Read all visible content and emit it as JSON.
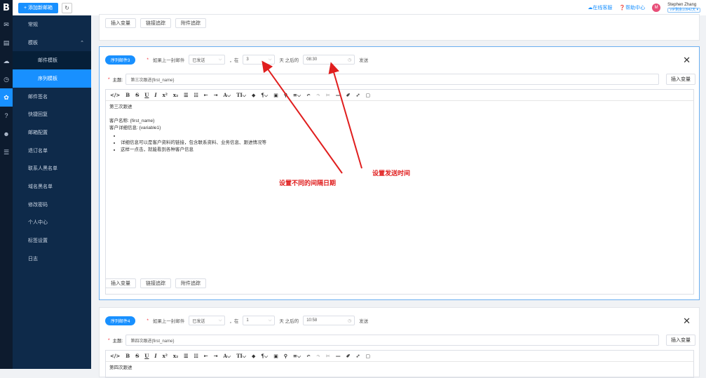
{
  "app": {
    "logo": "B"
  },
  "topbar": {
    "add_label": "+ 添加新邮箱",
    "online_service": "在线客服",
    "help_center": "帮助中心",
    "avatar_letter": "M",
    "user_name": "Stephen Zhang",
    "vip_label": "VIP剩余10942天 ▾"
  },
  "sidebar": {
    "items": [
      {
        "label": "常规"
      },
      {
        "label": "模板",
        "chevron": "⌃"
      },
      {
        "label": "邮件模板"
      },
      {
        "label": "序列模板"
      },
      {
        "label": "邮件签名"
      },
      {
        "label": "快捷回复"
      },
      {
        "label": "邮箱配置"
      },
      {
        "label": "退订名单"
      },
      {
        "label": "联系人黑名单"
      },
      {
        "label": "域名黑名单"
      },
      {
        "label": "修改密码"
      },
      {
        "label": "个人中心"
      },
      {
        "label": "标签设置"
      },
      {
        "label": "日志"
      }
    ]
  },
  "buttons": {
    "insert_variable": "插入变量",
    "link_tracking": "链接追踪",
    "attachment_tracking": "附件追踪",
    "insert_variable_subject": "插入变量"
  },
  "sequence3": {
    "tag": "序列邮件3",
    "condition_label": "如果上一封邮件",
    "condition_value": "已发送",
    "comma_at": "，在",
    "days_value": "3",
    "days_after": "天 之后的",
    "time_value": "08:30",
    "send": "发送",
    "subject_label": "主题:",
    "subject_value": "第三次跟进{first_name}",
    "body": {
      "line1": "第三次跟进",
      "line2": "客户名称: {first_name}",
      "line3": "客户详细信息: {variable1}",
      "bullets": [
        "",
        "详细信息可以是客户资料的链接，包含联系资料、业务信息、跟进情况等",
        "这样一点击，就能看到各种客户信息"
      ]
    }
  },
  "sequence4": {
    "tag": "序列邮件4",
    "condition_label": "如果上一封邮件",
    "condition_value": "已发送",
    "comma_at": "，在",
    "days_value": "1",
    "days_after": "天 之后的",
    "time_value": "10:58",
    "send": "发送",
    "subject_label": "主题:",
    "subject_value": "第四次跟进{first_name}",
    "body_partial": "第四次跟进"
  },
  "annotations": {
    "interval": "设置不同的间隔日期",
    "send_time": "设置发送时间"
  },
  "colors": {
    "accent": "#1890ff",
    "annotation": "#e01e1e",
    "sidebar": "#0e2a4a"
  }
}
